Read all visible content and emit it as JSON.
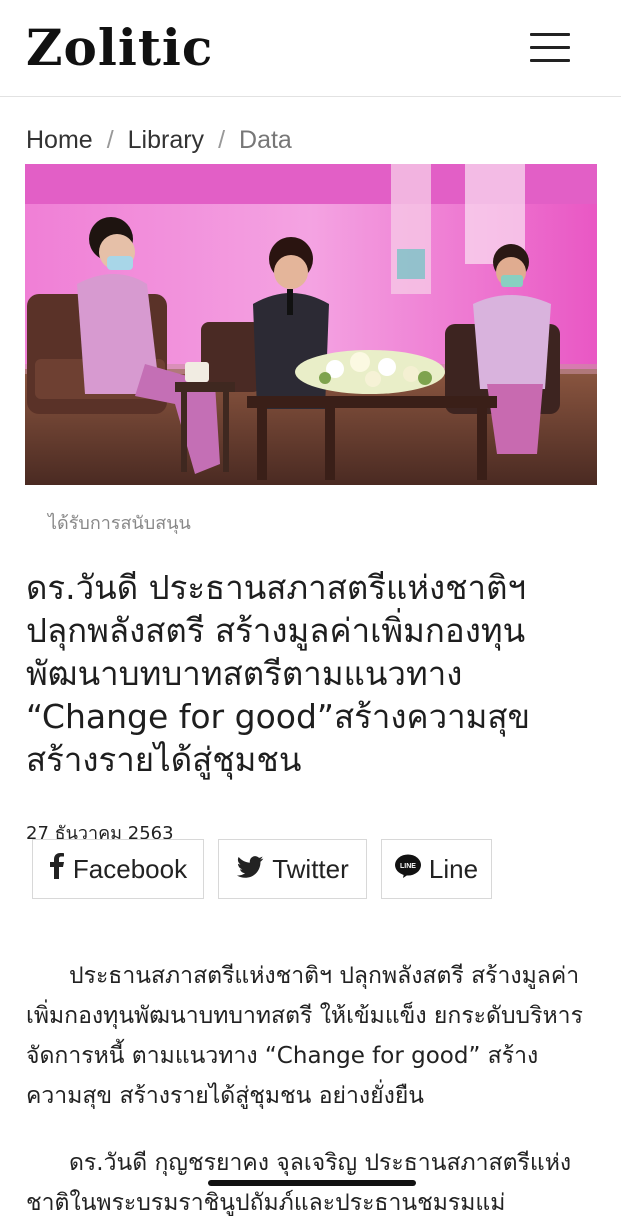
{
  "header": {
    "logo": "Zolitic",
    "menu_icon": "hamburger-menu-icon"
  },
  "breadcrumb": {
    "home": "Home",
    "library": "Library",
    "current": "Data",
    "separator": "/"
  },
  "hero": {
    "caption": "ได้รับการสนับสนุน"
  },
  "article": {
    "title_lines": [
      "ดร.วันดี ประธานสภาสตรีแห่งชาติฯ",
      "ปลุกพลังสตรี สร้างมูลค่าเพิ่มกองทุน",
      "พัฒนาบทบาทสตรีตามแนวทาง",
      "“Change for good”สร้างความสุข",
      "สร้างรายได้สู่ชุมชน"
    ],
    "date": "27 ธันวาคม 2563",
    "paragraph1": "ประธานสภาสตรีแห่งชาติฯ ปลุกพลังสตรี สร้างมูลค่าเพิ่มกองทุนพัฒนาบทบาทสตรี ให้เข้มแข็ง ยกระดับบริหารจัดการหนี้ ตามแนวทาง “Change for good” สร้างความสุข สร้างรายได้สู่ชุมชน อย่างยั่งยืน",
    "paragraph2": "ดร.วันดี กุญชรยาคง จุลเจริญ ประธานสภาสตรีแห่งชาติในพระบรมราชินูปถัมภ์และประธานชมรมแม่"
  },
  "share": {
    "facebook": "Facebook",
    "twitter": "Twitter",
    "line": "Line",
    "line_icon_text": "LINE"
  },
  "colors": {
    "line_green": "#000000",
    "hero_pink": "#e95bc9"
  }
}
